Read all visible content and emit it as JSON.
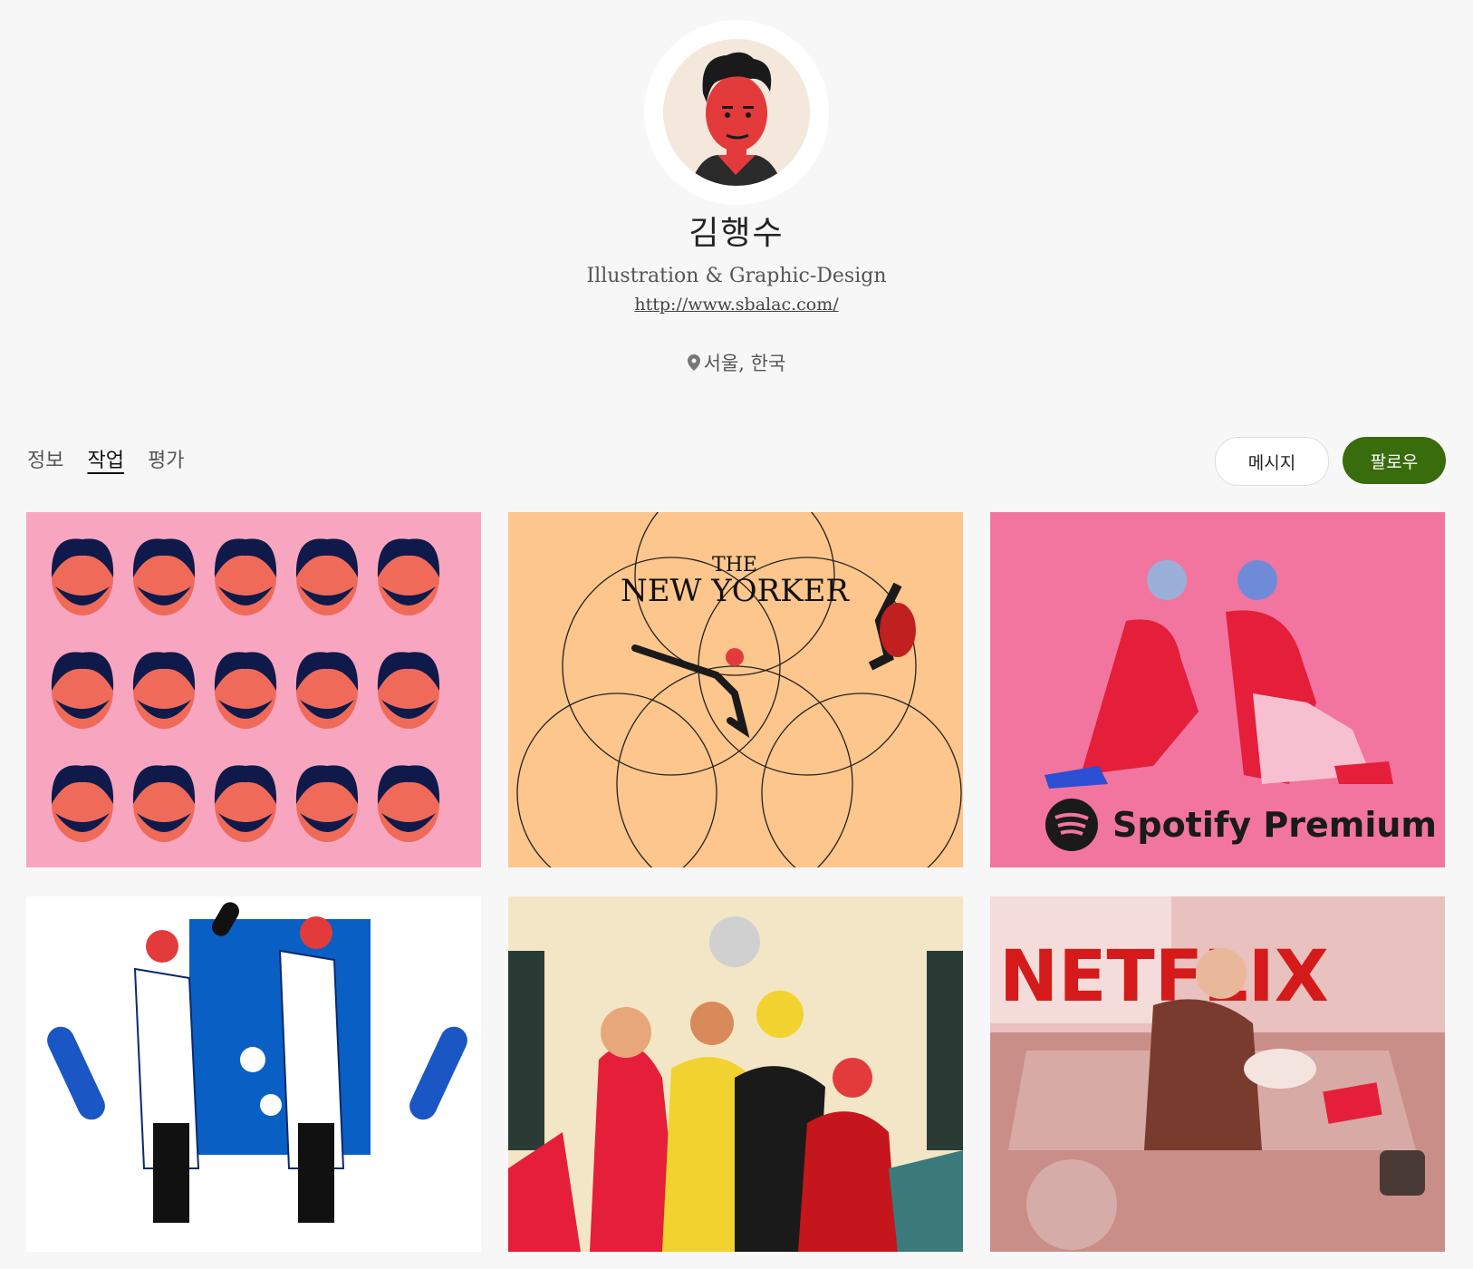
{
  "profile": {
    "name": "김행수",
    "tagline": "Illustration & Graphic-Design",
    "url": "http://www.sbalac.com/",
    "location": "서울, 한국"
  },
  "tabs": [
    {
      "label": "정보"
    },
    {
      "label": "작업",
      "active": true
    },
    {
      "label": "평가"
    }
  ],
  "actions": {
    "message_label": "메시지",
    "follow_label": "팔로우"
  },
  "colors": {
    "follow_bg": "#386c0c",
    "background": "#f7f7f7"
  },
  "works": [
    {
      "bg": "#f8a6c0",
      "text": ""
    },
    {
      "bg": "#fcc68c",
      "text_line1": "THE",
      "text_line2": "NEW YORKER"
    },
    {
      "bg": "#f275a0",
      "text": "Spotify Premium"
    },
    {
      "bg": "#ffffff",
      "text": ""
    },
    {
      "bg": "#f3e6c6",
      "text": ""
    },
    {
      "bg": "#e9c1bf",
      "text": "NETFLIX"
    }
  ]
}
